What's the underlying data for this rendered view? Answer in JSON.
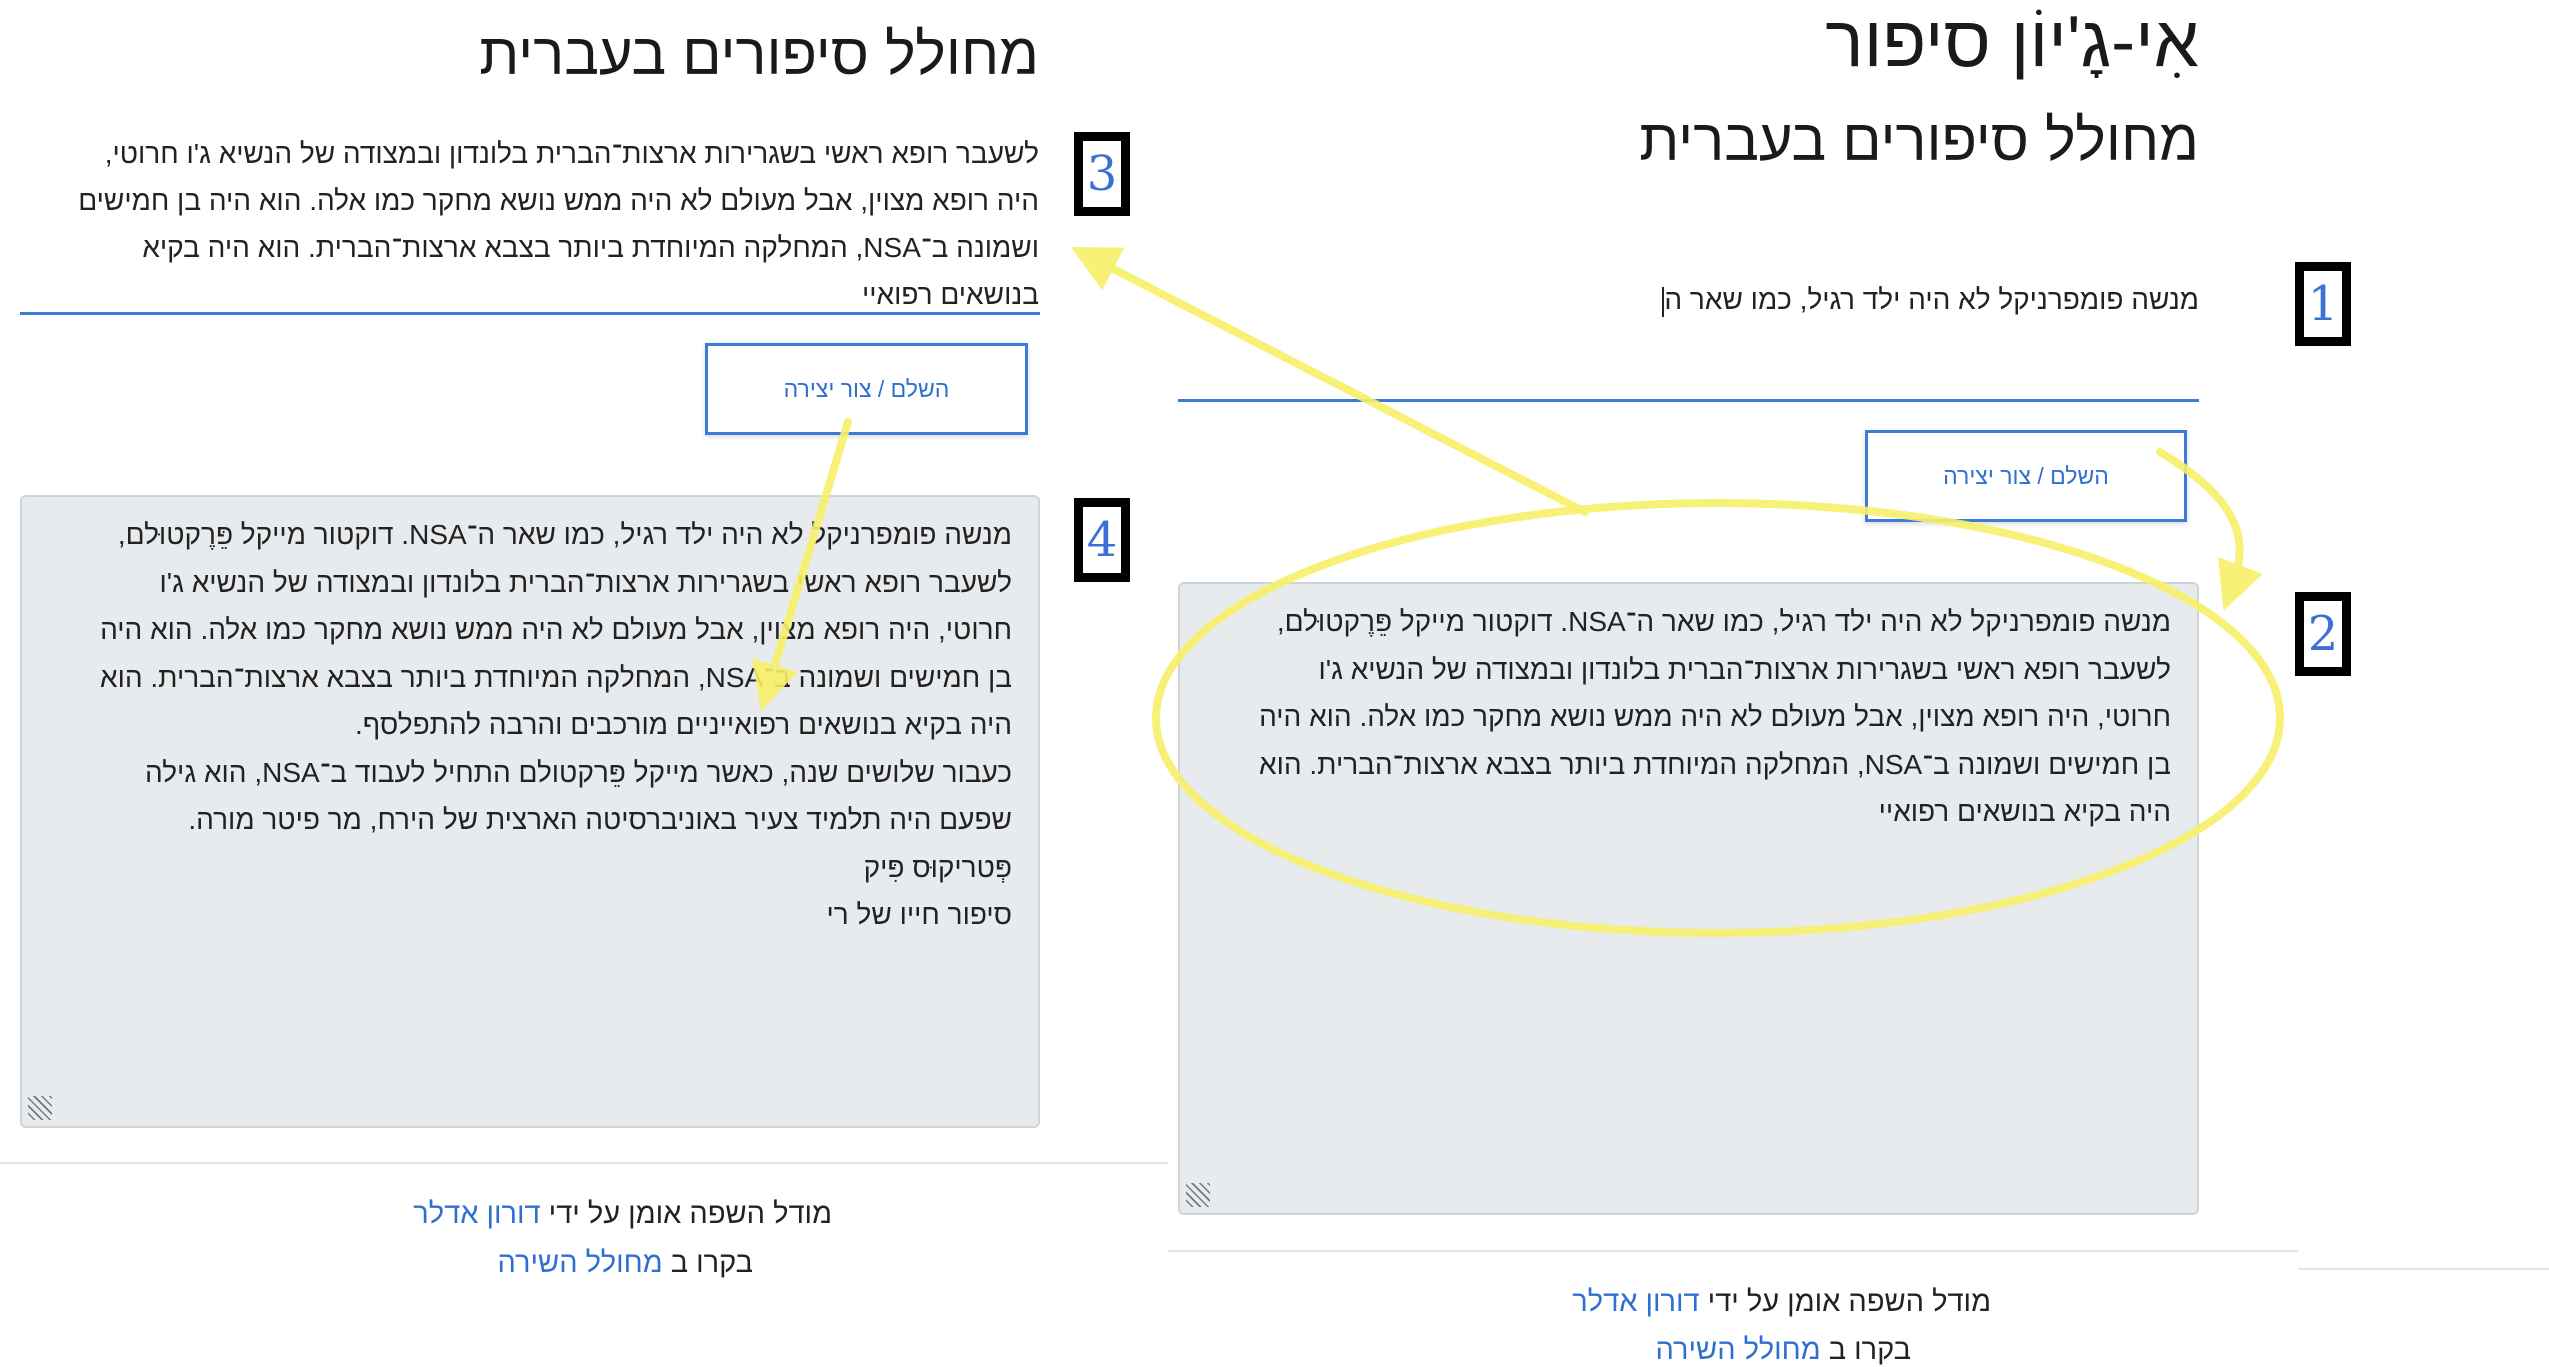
{
  "right_panel": {
    "app_title": "אִי-גָ'יוֹן סיפור",
    "subtitle": "מחולל סיפורים בעברית",
    "input_value": "מנשה פומפרניקל לא היה ילד רגיל, כמו שאר ה",
    "button_label": "השלם / צור יצירה",
    "output_lines": [
      "מנשה פומפרניקל לא היה ילד רגיל, כמו שאר ה־NSA. דוקטור מייקל פֵּרֶקטוּלם,",
      "לשעבר רופא ראשי בשגרירות ארצות־הברית בלונדון ובמצודה של הנשיא ג'ו",
      "חרוטי, היה רופא מצוין, אבל מעולם לא היה ממש נושא מחקר כמו אלה. הוא היה",
      "בן חמישים ושמונה ב־NSA, המחלקה המיוחדת ביותר בצבא ארצות־הברית. הוא",
      "היה בקיא בנושאים רפואיי"
    ],
    "footer_trained_prefix": "מודל השפה אומן על ידי ",
    "footer_author": "דורון אדלר",
    "footer_visit_prefix": "בקרו ב ",
    "footer_visit_link": "מחולל השירה"
  },
  "left_panel": {
    "subtitle": "מחולל סיפורים בעברית",
    "input_lines": [
      "לשעבר רופא ראשי בשגרירות ארצות־הברית בלונדון ובמצודה של הנשיא ג'ו חרוטי,",
      "היה רופא מצוין, אבל מעולם לא היה ממש נושא מחקר כמו אלה. הוא היה בן חמישים",
      "ושמונה ב־NSA, המחלקה המיוחדת ביותר בצבא ארצות־הברית. הוא היה בקיא",
      "בנושאים רפואיי"
    ],
    "button_label": "השלם / צור יצירה",
    "output_lines": [
      "מנשה פומפרניקל לא היה ילד רגיל, כמו שאר ה־NSA. דוקטור מייקל פֵּרֶקטוּלם,",
      "לשעבר רופא ראשי בשגרירות ארצות־הברית בלונדון ובמצודה של הנשיא ג'ו",
      "חרוטי, היה רופא מצוין, אבל מעולם לא היה ממש נושא מחקר כמו אלה. הוא היה",
      "בן חמישים ושמונה ב־NSA, המחלקה המיוחדת ביותר בצבא ארצות־הברית. הוא",
      "היה בקיא בנושאים רפואייניים מורכבים והרבה להתפלסף.",
      "כעבור שלושים שנה, כאשר מייקל פֵּרקטולם התחיל לעבוד ב־NSA, הוא גילה",
      "שפעם היה תלמיד צעיר באוניברסיטה הארצית של הירח, מר פיטר מורה.",
      "פְּטריקוּס פִּיק",
      "סיפור חייו של רי"
    ],
    "footer_trained_prefix": "מודל השפה אומן על ידי ",
    "footer_author": "דורון אדלר",
    "footer_visit_prefix": "בקרו ב ",
    "footer_visit_link": "מחולל השירה"
  },
  "step_labels": [
    "1",
    "2",
    "3",
    "4"
  ],
  "annotation_color": "#f7f06a",
  "accent_color": "#3d7bd9"
}
